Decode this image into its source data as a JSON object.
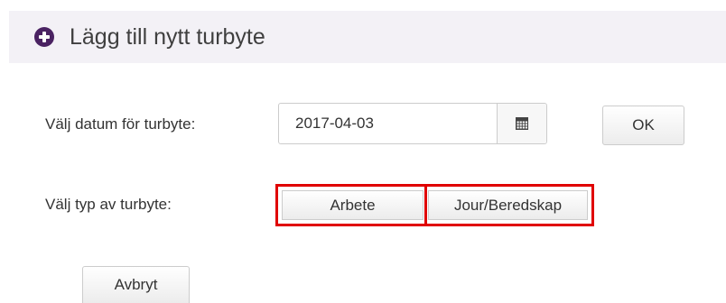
{
  "header": {
    "icon": "plus-circle-icon",
    "icon_color": "#4a2262",
    "title": "Lägg till nytt turbyte"
  },
  "date_row": {
    "label": "Välj datum för turbyte:",
    "date_value": "2017-04-03",
    "calendar_icon": "calendar-icon",
    "ok_label": "OK"
  },
  "type_row": {
    "label": "Välj typ av turbyte:",
    "options": [
      "Arbete",
      "Jour/Beredskap"
    ],
    "highlight_color": "#e00000"
  },
  "actions": {
    "cancel_label": "Avbryt"
  }
}
